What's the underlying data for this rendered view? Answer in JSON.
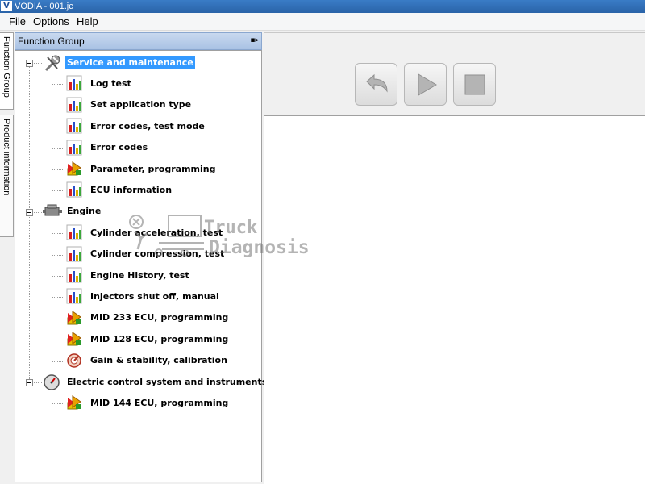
{
  "window": {
    "title": "VODIA - 001.jc",
    "app_icon": "V"
  },
  "menu": [
    "File",
    "Options",
    "Help"
  ],
  "side_tabs": [
    "Function Group",
    "Product information"
  ],
  "function_group": {
    "header": "Function Group",
    "groups": [
      {
        "label": "Service and maintenance",
        "icon": "wrench-screwdriver-icon",
        "selected": true,
        "items": [
          {
            "label": "Log test",
            "icon": "bar-chart-icon"
          },
          {
            "label": "Set application type",
            "icon": "bar-chart-icon"
          },
          {
            "label": "Error codes, test mode",
            "icon": "bar-chart-icon"
          },
          {
            "label": "Error codes",
            "icon": "bar-chart-icon"
          },
          {
            "label": "Parameter, programming",
            "icon": "programming-arrow-icon"
          },
          {
            "label": "ECU information",
            "icon": "bar-chart-icon"
          }
        ]
      },
      {
        "label": "Engine",
        "icon": "engine-icon",
        "selected": false,
        "items": [
          {
            "label": "Cylinder acceleration, test",
            "icon": "bar-chart-icon"
          },
          {
            "label": "Cylinder compression, test",
            "icon": "bar-chart-icon"
          },
          {
            "label": "Engine History, test",
            "icon": "bar-chart-icon"
          },
          {
            "label": "Injectors shut off, manual",
            "icon": "bar-chart-icon"
          },
          {
            "label": "MID 233 ECU, programming",
            "icon": "programming-arrow-icon"
          },
          {
            "label": "MID 128 ECU, programming",
            "icon": "programming-arrow-icon"
          },
          {
            "label": "Gain & stability, calibration",
            "icon": "calibration-dial-icon"
          }
        ]
      },
      {
        "label": "Electric control system and instruments",
        "icon": "gauge-icon",
        "selected": false,
        "items": [
          {
            "label": "MID 144 ECU, programming",
            "icon": "programming-arrow-icon"
          }
        ]
      }
    ]
  },
  "toolbar": {
    "buttons": [
      {
        "name": "back-button",
        "icon": "back-arrow-icon"
      },
      {
        "name": "play-button",
        "icon": "play-icon"
      },
      {
        "name": "stop-button",
        "icon": "stop-icon"
      }
    ]
  },
  "watermark": {
    "line1": "Truck",
    "line2": "Diagnosis"
  },
  "colors": {
    "selection": "#3399ff",
    "titlebar": "#2a63a8"
  }
}
